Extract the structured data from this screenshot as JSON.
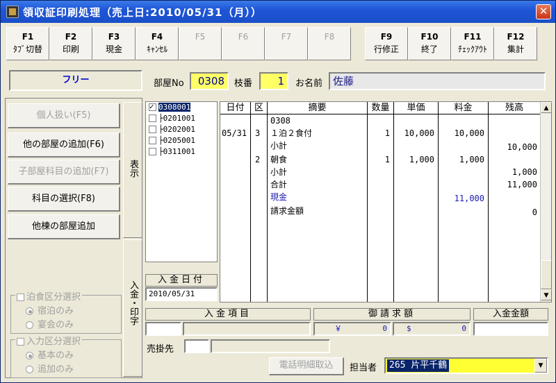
{
  "window": {
    "title": "領収証印刷処理（売上日:2010/05/31（月））",
    "close_label": "✕"
  },
  "fkeys": [
    {
      "num": "F1",
      "label": "ﾀﾌﾞ切替",
      "enabled": true
    },
    {
      "num": "F2",
      "label": "印刷",
      "enabled": true
    },
    {
      "num": "F3",
      "label": "現金",
      "enabled": true
    },
    {
      "num": "F4",
      "label": "ｷｬﾝｾﾙ",
      "enabled": true
    },
    {
      "num": "F5",
      "label": "",
      "enabled": false
    },
    {
      "num": "F6",
      "label": "",
      "enabled": false
    },
    {
      "num": "F7",
      "label": "",
      "enabled": false
    },
    {
      "num": "F8",
      "label": "",
      "enabled": false
    },
    {
      "num": "F9",
      "label": "行修正",
      "enabled": true
    },
    {
      "num": "F10",
      "label": "終了",
      "enabled": true
    },
    {
      "num": "F11",
      "label": "ﾁｪｯｸｱｳﾄ",
      "enabled": true
    },
    {
      "num": "F12",
      "label": "集計",
      "enabled": true
    }
  ],
  "header": {
    "mode_label": "フリー",
    "room_label": "部屋No",
    "room_value": "0308",
    "branch_label": "枝番",
    "branch_value": "1",
    "name_label": "お名前",
    "name_value": "佐藤"
  },
  "side_buttons": [
    {
      "label": "個人扱い(F5)",
      "enabled": false
    },
    {
      "label": "他の部屋の追加(F6)",
      "enabled": true
    },
    {
      "label": "子部屋科目の追加(F7)",
      "enabled": false
    },
    {
      "label": "科目の選択(F8)",
      "enabled": true
    },
    {
      "label": "他棟の部屋追加",
      "enabled": true
    }
  ],
  "tabs": {
    "display": "表示",
    "payment": "入金・印字"
  },
  "tree": [
    {
      "text": "0308001",
      "checked": true,
      "selected": true,
      "prefix": ""
    },
    {
      "text": "0201001",
      "checked": false,
      "selected": false,
      "prefix": "├"
    },
    {
      "text": "0202001",
      "checked": false,
      "selected": false,
      "prefix": "├"
    },
    {
      "text": "0205001",
      "checked": false,
      "selected": false,
      "prefix": "├"
    },
    {
      "text": "0311001",
      "checked": false,
      "selected": false,
      "prefix": "├"
    }
  ],
  "grid": {
    "headers": [
      "日付",
      "区",
      "摘要",
      "数量",
      "単価",
      "料金",
      "残高"
    ],
    "rows": [
      {
        "date": "",
        "kubun": "",
        "desc": "0308",
        "qty": "",
        "price": "",
        "fee": "",
        "balance": "",
        "blue": false
      },
      {
        "date": "05/31",
        "kubun": "3",
        "desc": "１泊２食付",
        "qty": "1",
        "price": "10,000",
        "fee": "10,000",
        "balance": "",
        "blue": false
      },
      {
        "date": "",
        "kubun": "",
        "desc": "小計",
        "qty": "",
        "price": "",
        "fee": "",
        "balance": "10,000",
        "blue": false
      },
      {
        "date": "",
        "kubun": "2",
        "desc": "朝食",
        "qty": "1",
        "price": "1,000",
        "fee": "1,000",
        "balance": "",
        "blue": false
      },
      {
        "date": "",
        "kubun": "",
        "desc": "小計",
        "qty": "",
        "price": "",
        "fee": "",
        "balance": "1,000",
        "blue": false
      },
      {
        "date": "",
        "kubun": "",
        "desc": "合計",
        "qty": "",
        "price": "",
        "fee": "",
        "balance": "11,000",
        "blue": false
      },
      {
        "date": "",
        "kubun": "",
        "desc": "現金",
        "qty": "",
        "price": "",
        "fee": "11,000",
        "balance": "",
        "blue": true
      },
      {
        "date": "",
        "kubun": "",
        "desc": "請求金額",
        "qty": "",
        "price": "",
        "fee": "",
        "balance": "0",
        "blue": false
      }
    ]
  },
  "payment": {
    "date_label": "入金日付",
    "date_value": "2010/05/31",
    "item_label": "入金項目",
    "invoice_label": "御請求額",
    "amount_label": "入金金額",
    "yen_symbol": "￥",
    "yen_value": "0",
    "dollar_symbol": "$",
    "dollar_value": "0",
    "account_label": "売掛先"
  },
  "options": {
    "stay_group_label": "泊食区分選択",
    "stay_opt1": "宿泊のみ",
    "stay_opt2": "宴会のみ",
    "input_group_label": "入力区分選択",
    "input_opt1": "基本のみ",
    "input_opt2": "追加のみ"
  },
  "footer": {
    "phone_button": "電話明細取込",
    "staff_label": "担当者",
    "staff_value": "265 片平千鶴"
  }
}
